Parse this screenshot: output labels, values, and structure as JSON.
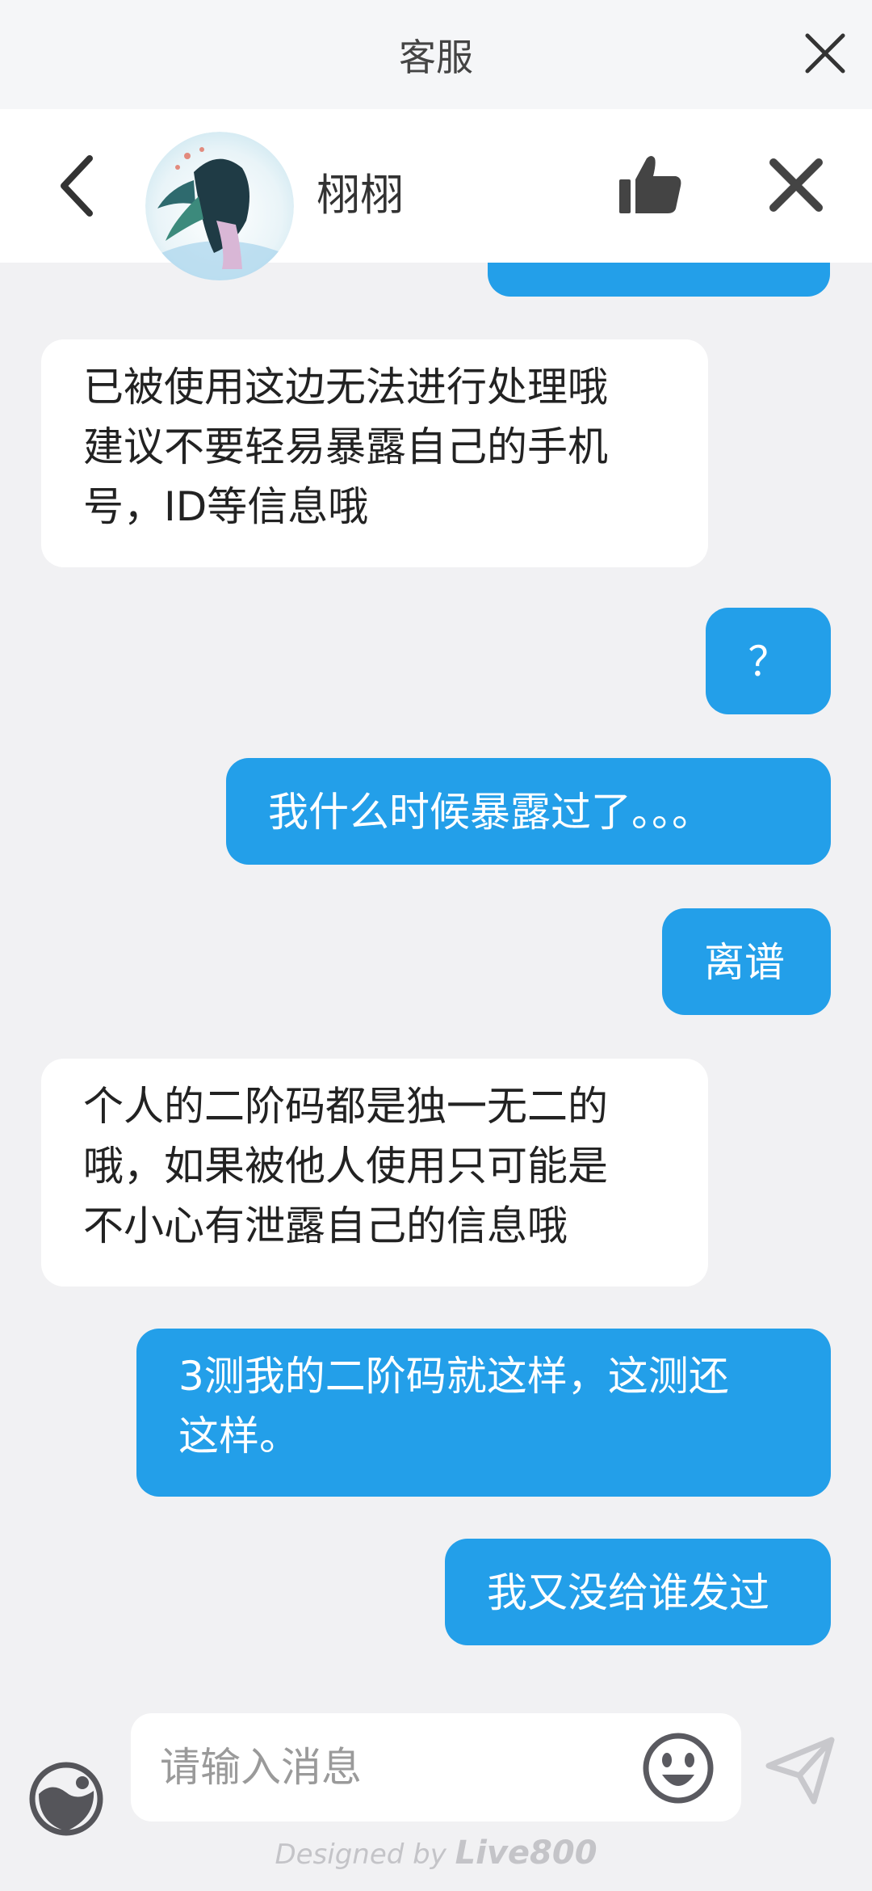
{
  "topbar": {
    "title": "客服"
  },
  "header": {
    "agent_name": "栩栩"
  },
  "messages": [
    {
      "from": "me",
      "text": ""
    },
    {
      "from": "agent",
      "text": "已被使用这边无法进行处理哦\n建议不要轻易暴露自己的手机\n号，ID等信息哦"
    },
    {
      "from": "me",
      "text": "？"
    },
    {
      "from": "me",
      "text": "我什么时候暴露过了。。。"
    },
    {
      "from": "me",
      "text": "离谱"
    },
    {
      "from": "agent",
      "text": "个人的二阶码都是独一无二的\n哦，如果被他人使用只可能是\n不小心有泄露自己的信息哦"
    },
    {
      "from": "me",
      "text": "3测我的二阶码就这样，这测还\n这样。"
    },
    {
      "from": "me",
      "text": "我又没给谁发过"
    }
  ],
  "composer": {
    "placeholder": "请输入消息"
  },
  "footer": {
    "prefix": "Designed by",
    "brand": "Live800"
  },
  "colors": {
    "outgoing_bubble": "#239fe9",
    "incoming_bubble": "#ffffff",
    "background": "#f1f1f3"
  },
  "icons": [
    "close-icon",
    "back-arrow-icon",
    "thumbs-up-icon",
    "theme-toggle-icon",
    "emoji-icon",
    "send-icon"
  ]
}
